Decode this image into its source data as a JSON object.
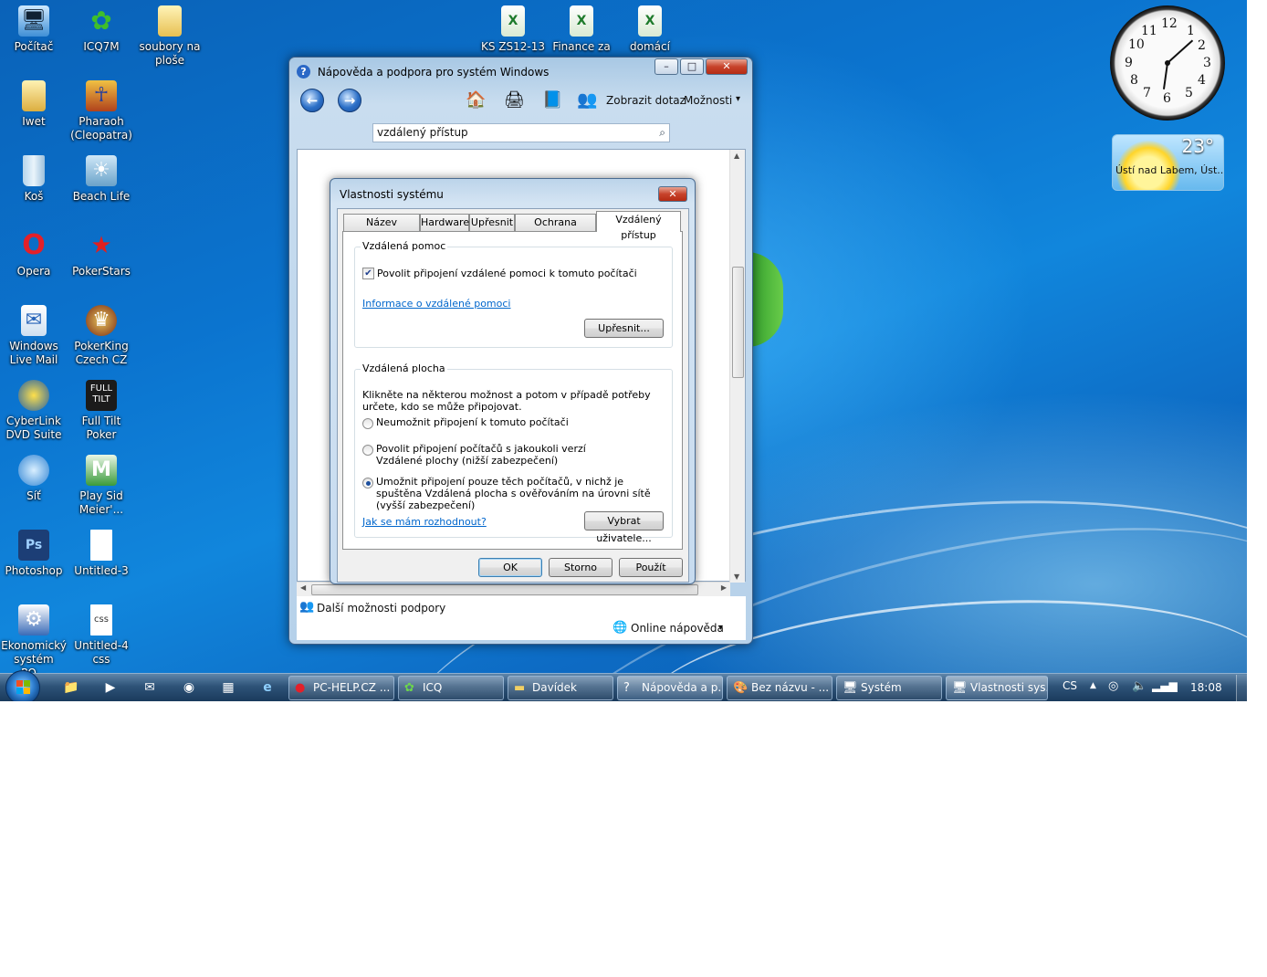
{
  "desktop_icons": [
    {
      "label": "Počítač",
      "icon": "computer-icon"
    },
    {
      "label": "ICQ7M",
      "icon": "icq-icon"
    },
    {
      "label": "soubory na ploše",
      "icon": "folder-icon"
    },
    {
      "label": "Iwet",
      "icon": "user-folder-icon"
    },
    {
      "label": "Pharaoh (Cleopatra)",
      "icon": "pharaoh-game-icon"
    },
    {
      "label": "Koš",
      "icon": "recycle-bin-icon"
    },
    {
      "label": "Beach Life",
      "icon": "beach-life-icon"
    },
    {
      "label": "Opera",
      "icon": "opera-icon"
    },
    {
      "label": "PokerStars",
      "icon": "pokerstars-icon"
    },
    {
      "label": "Windows Live Mail",
      "icon": "mail-icon"
    },
    {
      "label": "PokerKing Czech CZ",
      "icon": "pokerking-icon"
    },
    {
      "label": "CyberLink DVD Suite",
      "icon": "dvd-suite-icon"
    },
    {
      "label": "Full Tilt Poker",
      "icon": "full-tilt-icon"
    },
    {
      "label": "Síť",
      "icon": "network-icon"
    },
    {
      "label": "Play Sid Meier'...",
      "icon": "sid-meier-icon"
    },
    {
      "label": "Photoshop",
      "icon": "photoshop-icon"
    },
    {
      "label": "Untitled-3",
      "icon": "blank-file-icon"
    },
    {
      "label": "Ekonomický systém PO...",
      "icon": "economic-system-icon"
    },
    {
      "label": "Untitled-4 css",
      "icon": "css-file-icon"
    },
    {
      "label": "KS ZS12-13",
      "icon": "excel-file-icon"
    },
    {
      "label": "Finance za",
      "icon": "excel-file-icon"
    },
    {
      "label": "domácí",
      "icon": "excel-file-icon"
    }
  ],
  "gadgets": {
    "clock_numbers": [
      "12",
      "1",
      "2",
      "3",
      "4",
      "5",
      "6",
      "7",
      "8",
      "9",
      "10",
      "11"
    ],
    "weather": {
      "temperature": "23°",
      "location": "Ústí nad Labem, Úst..."
    }
  },
  "help_window": {
    "title": "Nápověda a podpora pro systém Windows",
    "caption_buttons": {
      "minimize": "–",
      "maximize": "□",
      "close": "✕"
    },
    "toolbar": {
      "ask": "Zobrazit dotaz",
      "options": "Možnosti",
      "options_arrow": "▾"
    },
    "search": {
      "value": "vzdálený přístup",
      "icon": "search-icon"
    },
    "more_support": "Další možnosti podpory",
    "online_help": "Online nápověda",
    "online_arrow": "▾"
  },
  "system_dialog": {
    "title": "Vlastnosti systému",
    "tabs": [
      "Název počítače",
      "Hardware",
      "Upřesnit",
      "Ochrana systému",
      "Vzdálený přístup"
    ],
    "active_tab": "Vzdálený přístup",
    "remote_assistance": {
      "group": "Vzdálená pomoc",
      "checkbox_label": "Povolit připojení vzdálené pomoci k tomuto počítači",
      "checked": true,
      "link": "Informace o vzdálené pomoci",
      "advanced_button": "Upřesnit..."
    },
    "remote_desktop": {
      "group": "Vzdálená plocha",
      "description": "Klikněte na některou možnost a potom v případě potřeby určete, kdo se může připojovat.",
      "options": [
        {
          "label": "Neumožnit připojení k tomuto počítači",
          "selected": false
        },
        {
          "label": "Povolit připojení počítačů s jakoukoli verzí Vzdálené plochy (nižší zabezpečení)",
          "selected": false
        },
        {
          "label": "Umožnit připojení pouze těch počítačů, v nichž je spuštěna Vzdálená plocha s ověřováním na úrovni sítě (vyšší zabezpečení)",
          "selected": true
        }
      ],
      "help_link": "Jak se mám rozhodnout?",
      "select_users_button": "Vybrat uživatele..."
    },
    "buttons": {
      "ok": "OK",
      "cancel": "Storno",
      "apply": "Použít"
    }
  },
  "taskbar": {
    "tasks": [
      {
        "label": "PC-HELP.CZ ...",
        "icon": "opera-icon"
      },
      {
        "label": "ICQ",
        "icon": "icq-icon"
      },
      {
        "label": "Davídek",
        "icon": "folder-icon"
      },
      {
        "label": "Nápověda a p...",
        "icon": "help-icon"
      },
      {
        "label": "Bez názvu - ...",
        "icon": "paint-icon"
      },
      {
        "label": "Systém",
        "icon": "system-icon"
      },
      {
        "label": "Vlastnosti sys...",
        "icon": "system-icon"
      }
    ],
    "language": "CS",
    "time": "18:08"
  }
}
